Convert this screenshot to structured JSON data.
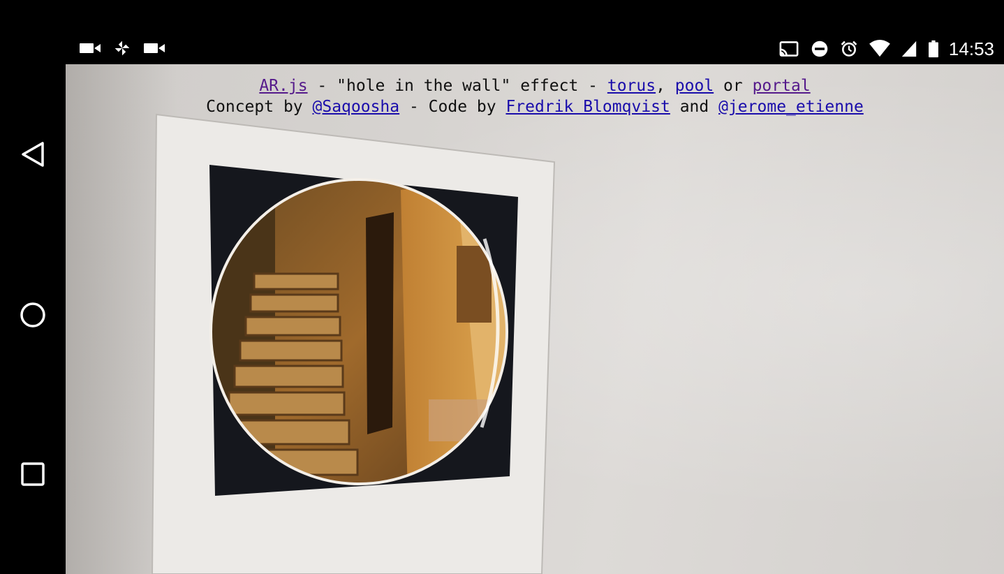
{
  "status_bar": {
    "left_icons": [
      "video-camera-icon",
      "pinwheel-icon",
      "video-camera-icon"
    ],
    "right_icons": [
      "cast-icon",
      "do-not-disturb-icon",
      "alarm-icon",
      "wifi-icon",
      "signal-icon",
      "battery-icon"
    ],
    "time": "14:53"
  },
  "nav_bar": {
    "buttons": [
      "back",
      "home",
      "recents"
    ]
  },
  "info": {
    "line1": {
      "arjs_link": "AR.js",
      "text_a": " - \"hole in the wall\" effect - ",
      "torus_link": "torus",
      "comma": ", ",
      "pool_link": "pool",
      "or": " or ",
      "portal_link": "portal"
    },
    "line2": {
      "concept": "Concept by ",
      "saqoosha_link": "@Saqoosha",
      "code_by": " - Code by ",
      "fredrik_link": "Fredrik Blomqvist",
      "and": " and ",
      "jerome_link": "@jerome_etienne"
    }
  },
  "colors": {
    "link": "#1a0dab",
    "visited_link": "#551a8b",
    "text": "#111111",
    "wall": "#d6d3d0",
    "marker_black": "#15171d"
  }
}
